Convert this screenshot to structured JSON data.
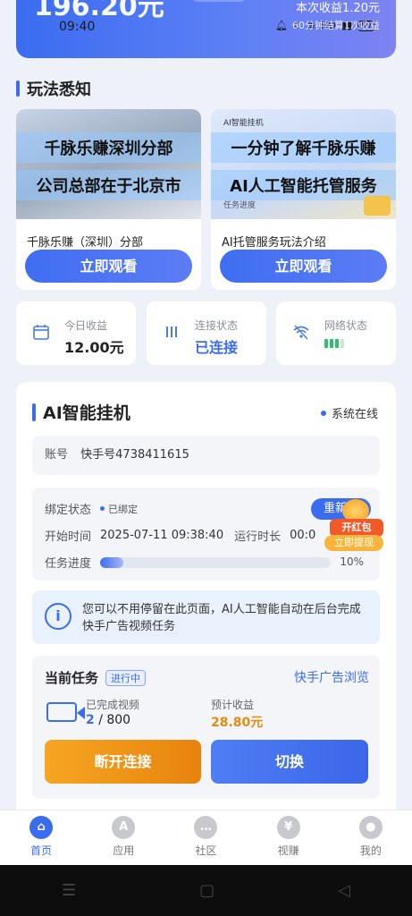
{
  "banner": {
    "big_amount": "196.20元",
    "time": "09:40",
    "earn": "本次收益1.20元",
    "sub": "60分钟结算1次收益",
    "battery": "80"
  },
  "guide": {
    "title": "玩法悉知",
    "cards": [
      {
        "cap1": "千脉乐赚深圳分部",
        "cap2": "公司总部在于北京市",
        "title": "千脉乐赚（深圳）分部",
        "button": "立即观看"
      },
      {
        "tag": "AI智能挂机",
        "cap1": "一分钟了解千脉乐赚",
        "cap2": "AI人工智能托管服务",
        "foot": "任务进度",
        "title": "AI托管服务玩法介绍",
        "button": "立即观看"
      }
    ]
  },
  "stats": {
    "income_label": "今日收益",
    "income_value": "12.00元",
    "conn_label": "连接状态",
    "conn_value": "已连接",
    "net_label": "网络状态",
    "signal_level": 0.75
  },
  "ai": {
    "title": "AI智能挂机",
    "online": "系统在线",
    "account_label": "账号",
    "account_value": "快手号4738411615",
    "bind_label": "绑定状态",
    "bind_value": "已绑定",
    "rebind_button": "重新绑",
    "start_label": "开始时间",
    "start_value": "2025-07-11 09:38:40",
    "runtime_label": "运行时长",
    "runtime_value": "00:0",
    "progress_label": "任务进度",
    "progress_pct": "10%",
    "progress_fraction": 0.1,
    "info": "您可以不用停留在此页面，AI人工智能自动在后台完成快手广告视频任务",
    "task_title": "当前任务",
    "task_badge": "进行中",
    "task_link": "快手广告浏览",
    "done_label": "已完成视频",
    "done_current": "2",
    "done_total": " / 800",
    "expected_label": "预计收益",
    "expected_value": "28.80元",
    "disconnect_button": "断开连接",
    "switch_button": "切换"
  },
  "redpack": {
    "line1": "开红包",
    "line2": "立即提现"
  },
  "tabs": [
    {
      "label": "首页",
      "icon": "home-icon",
      "glyph": "⌂"
    },
    {
      "label": "应用",
      "icon": "app-icon",
      "glyph": "A"
    },
    {
      "label": "社区",
      "icon": "chat-icon",
      "glyph": "…"
    },
    {
      "label": "视赚",
      "icon": "yen-icon",
      "glyph": "¥"
    },
    {
      "label": "我的",
      "icon": "user-icon",
      "glyph": "●"
    }
  ]
}
